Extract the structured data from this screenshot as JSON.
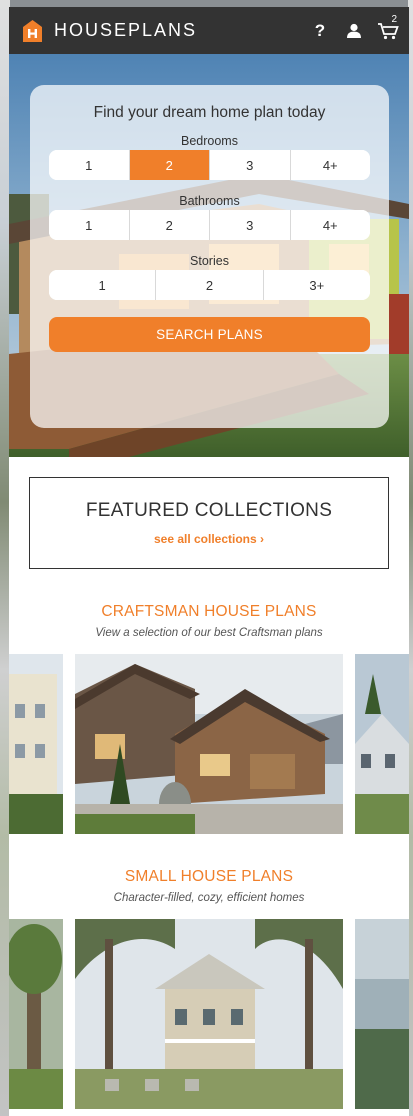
{
  "header": {
    "logo_text": "HOUSEPLANS",
    "help_icon": "help-icon",
    "user_icon": "user-icon",
    "cart_icon": "cart-icon",
    "cart_count": "2"
  },
  "search": {
    "title": "Find your dream home plan today",
    "bedrooms_label": "Bedrooms",
    "bedrooms_options": [
      "1",
      "2",
      "3",
      "4+"
    ],
    "bedrooms_selected": "2",
    "bathrooms_label": "Bathrooms",
    "bathrooms_options": [
      "1",
      "2",
      "3",
      "4+"
    ],
    "stories_label": "Stories",
    "stories_options": [
      "1",
      "2",
      "3+"
    ],
    "button_label": "SEARCH PLANS"
  },
  "featured": {
    "title": "FEATURED COLLECTIONS",
    "link_label": "see all collections ›"
  },
  "collections": [
    {
      "title": "CRAFTSMAN HOUSE PLANS",
      "subtitle": "View a selection of our best Craftsman plans"
    },
    {
      "title": "SMALL HOUSE PLANS",
      "subtitle": "Character-filled, cozy, efficient homes"
    }
  ],
  "colors": {
    "accent": "#f07f2a",
    "header_bg": "#333333"
  }
}
